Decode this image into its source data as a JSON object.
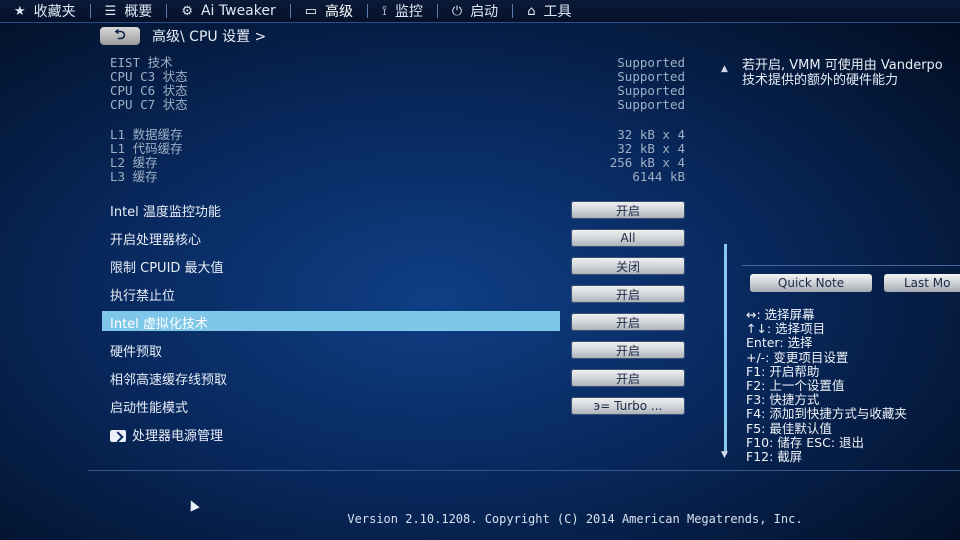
{
  "tabs": [
    {
      "icon": "★",
      "label": "收藏夹"
    },
    {
      "icon": "☰",
      "label": "概要"
    },
    {
      "icon": "⚙",
      "label": "Ai Tweaker"
    },
    {
      "icon": "▭",
      "label": "高级"
    },
    {
      "icon": "⟟",
      "label": "监控"
    },
    {
      "icon": "⏻",
      "label": "启动"
    },
    {
      "icon": "⌂",
      "label": "工具"
    }
  ],
  "breadcrumb": {
    "back": "⮌",
    "path": "高级\\ CPU 设置 >"
  },
  "info": [
    {
      "label": "EIST 技术",
      "value": "Supported"
    },
    {
      "label": "CPU C3 状态",
      "value": "Supported"
    },
    {
      "label": "CPU C6 状态",
      "value": "Supported"
    },
    {
      "label": "CPU C7 状态",
      "value": "Supported"
    }
  ],
  "cache": [
    {
      "label": "L1 数据缓存",
      "value": "32 kB x 4"
    },
    {
      "label": "L1 代码缓存",
      "value": "32 kB x 4"
    },
    {
      "label": "L2 缓存",
      "value": "256 kB x 4"
    },
    {
      "label": "L3 缓存",
      "value": "6144 kB"
    }
  ],
  "settings": [
    {
      "label": "Intel 温度监控功能",
      "value": "开启"
    },
    {
      "label": "开启处理器核心",
      "value": "All"
    },
    {
      "label": "限制 CPUID 最大值",
      "value": "关闭"
    },
    {
      "label": "执行禁止位",
      "value": "开启"
    },
    {
      "label": "Intel 虚拟化技术",
      "value": "开启"
    },
    {
      "label": "硬件预取",
      "value": "开启"
    },
    {
      "label": "相邻高速缓存线预取",
      "value": "开启"
    },
    {
      "label": "启动性能模式",
      "value": "э= Turbo ..."
    }
  ],
  "submenu": "处理器电源管理",
  "description": [
    "若开启, VMM 可使用由 Vanderpo",
    "技术提供的额外的硬件能力"
  ],
  "quick_note": "Quick Note",
  "last_modified": "Last Mo",
  "help": [
    "↔: 选择屏幕",
    "↑↓: 选择项目",
    "Enter: 选择",
    "+/-: 变更项目设置",
    "F1: 开启帮助",
    "F2: 上一个设置值",
    "F3: 快捷方式",
    "F4: 添加到快捷方式与收藏夹",
    "F5: 最佳默认值",
    "F10: 储存  ESC: 退出",
    "F12: 截屏"
  ],
  "footer": "Version 2.10.1208. Copyright (C) 2014 American Megatrends, Inc."
}
